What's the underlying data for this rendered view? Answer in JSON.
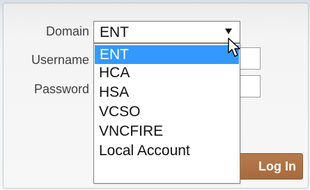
{
  "form": {
    "domain_label": "Domain",
    "username_label": "Username",
    "password_label": "Password",
    "domain_selected": "ENT",
    "domain_options": [
      "ENT",
      "HCA",
      "HSA",
      "VCSO",
      "VNCFIRE",
      "Local Account"
    ],
    "login_label": "Log In"
  },
  "colors": {
    "selection_highlight": "#3399ff",
    "login_button": "#a86a3f"
  }
}
